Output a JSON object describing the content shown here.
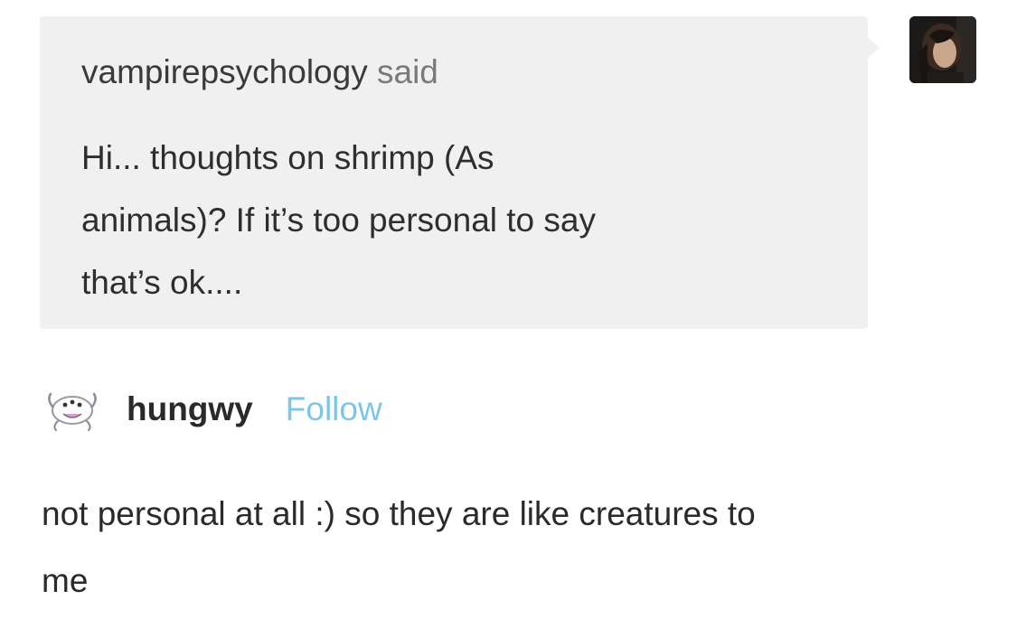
{
  "ask": {
    "asker": "vampirepsychology",
    "said": "said",
    "question_lines": [
      "Hi... thoughts on shrimp (As",
      "animals)? If it’s too personal to say",
      "that’s ok...."
    ],
    "avatar_icon": "user-photo-avatar"
  },
  "answer": {
    "username": "hungwy",
    "follow_label": "Follow",
    "avatar_icon": "pixel-creature-avatar",
    "body_lines": [
      "not personal at all :) so they are like creatures to",
      "me"
    ]
  },
  "colors": {
    "ask_background": "#f0f0f0",
    "follow_link": "#7dc6e6",
    "text": "#2a2a2a",
    "secondary_text": "#7a7a7a"
  }
}
